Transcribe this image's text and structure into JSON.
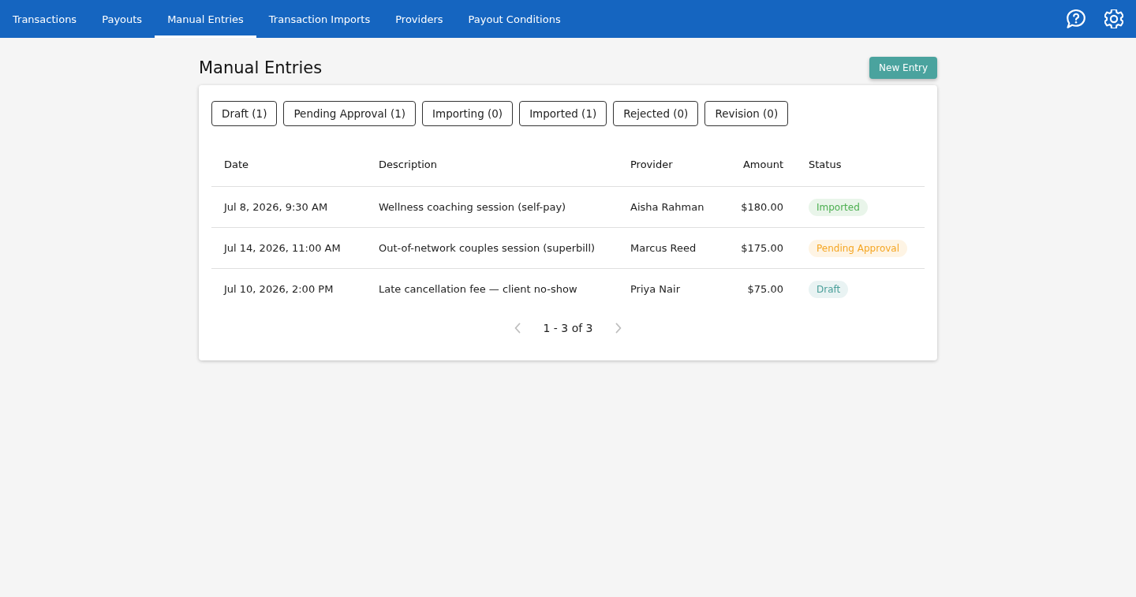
{
  "navigation": {
    "tabs": [
      {
        "label": "Transactions",
        "selected": false
      },
      {
        "label": "Payouts",
        "selected": false
      },
      {
        "label": "Manual Entries",
        "selected": true
      },
      {
        "label": "Transaction Imports",
        "selected": false
      },
      {
        "label": "Providers",
        "selected": false
      },
      {
        "label": "Payout Conditions",
        "selected": false
      }
    ],
    "actions": [
      {
        "kind": "help"
      },
      {
        "kind": "settings"
      }
    ]
  },
  "page": {
    "title": "Manual Entries",
    "primary_button": "New Entry"
  },
  "filters": [
    "Draft (1)",
    "Pending Approval (1)",
    "Importing (0)",
    "Imported (1)",
    "Rejected (0)",
    "Revision (0)"
  ],
  "table": {
    "columns": [
      "Date",
      "Description",
      "Provider",
      "Amount",
      "Status"
    ],
    "rows": [
      {
        "date": "Jul 8, 2026, 9:30 AM",
        "description": "Wellness coaching session (self-pay)",
        "provider": "Aisha Rahman",
        "amount": "$180.00",
        "status": {
          "label": "Imported",
          "color": "#4caf50"
        }
      },
      {
        "date": "Jul 14, 2026, 11:00 AM",
        "description": "Out-of-network couples session (superbill)",
        "provider": "Marcus Reed",
        "amount": "$175.00",
        "status": {
          "label": "Pending Approval",
          "color": "#f5a623"
        }
      },
      {
        "date": "Jul 10, 2026, 2:00 PM",
        "description": "Late cancellation fee — client no-show",
        "provider": "Priya Nair",
        "amount": "$75.00",
        "status": {
          "label": "Draft",
          "color": "#4a9f9a"
        }
      }
    ]
  },
  "pagination": {
    "range": "1 - 3 of 3",
    "previous": {
      "disabled": true
    },
    "next": {
      "disabled": true
    }
  }
}
